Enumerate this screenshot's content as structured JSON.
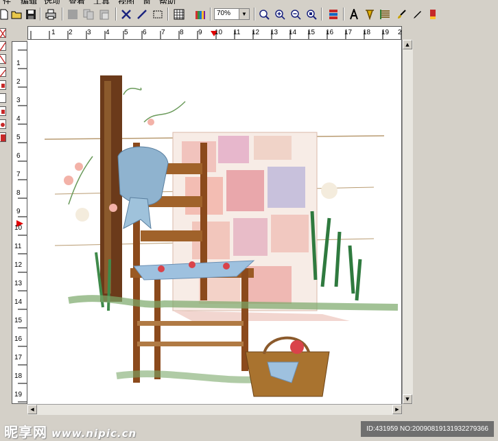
{
  "menu": {
    "items": [
      "件",
      "编辑",
      "选项",
      "查看",
      "工具",
      "视图",
      "窗",
      "帮助"
    ]
  },
  "toolbar": {
    "buttons": [
      "new-file-icon",
      "open-folder-icon",
      "save-icon",
      "print-icon",
      "fill-icon",
      "copy-icon",
      "paste-icon",
      "cross-stitch-icon",
      "back-stitch-icon",
      "select-rect-icon",
      "grid-icon",
      "palette-icon",
      "zoom-fit-icon",
      "zoom-in-icon",
      "zoom-out-icon",
      "zoom-full-icon",
      "floss-icon",
      "text-icon",
      "stitch-tool-icon",
      "list-icon",
      "brush-icon",
      "eyedropper-icon",
      "highlight-icon"
    ],
    "zoom_value": "70%",
    "zoom_dropdown_arrow": "▼"
  },
  "left_tools": [
    "tool-1",
    "tool-2",
    "tool-3",
    "tool-4",
    "tool-5",
    "tool-6",
    "tool-7",
    "tool-8",
    "tool-9"
  ],
  "ruler": {
    "top_numbers": [
      "1",
      "2",
      "3",
      "4",
      "5",
      "6",
      "7",
      "8",
      "9",
      "10",
      "11",
      "12",
      "13",
      "14",
      "15",
      "16",
      "17",
      "18",
      "19",
      "2"
    ],
    "left_numbers": [
      "1",
      "2",
      "3",
      "4",
      "5",
      "6",
      "7",
      "8",
      "9",
      "10",
      "11",
      "12",
      "13",
      "14",
      "15",
      "16",
      "17",
      "18",
      "19"
    ],
    "marker_color": "#ff0000"
  },
  "scrollbar": {
    "up": "▲",
    "down": "▼",
    "left": "◀",
    "right": "▶"
  },
  "watermark": {
    "site_name": "昵享网",
    "site_url": "www.nipic.cn",
    "image_id": "ID:431959 NO:20090819131932279366"
  },
  "colors": {
    "window_bg": "#d4d0c8",
    "canvas_bg": "#ffffff",
    "chair_wood": "#8b4a1c",
    "post_wood": "#6b3a1a",
    "bonnet_blue": "#8fb3cf",
    "quilt_pink": "#f2b7b0",
    "grass_green": "#3f8a4a"
  }
}
